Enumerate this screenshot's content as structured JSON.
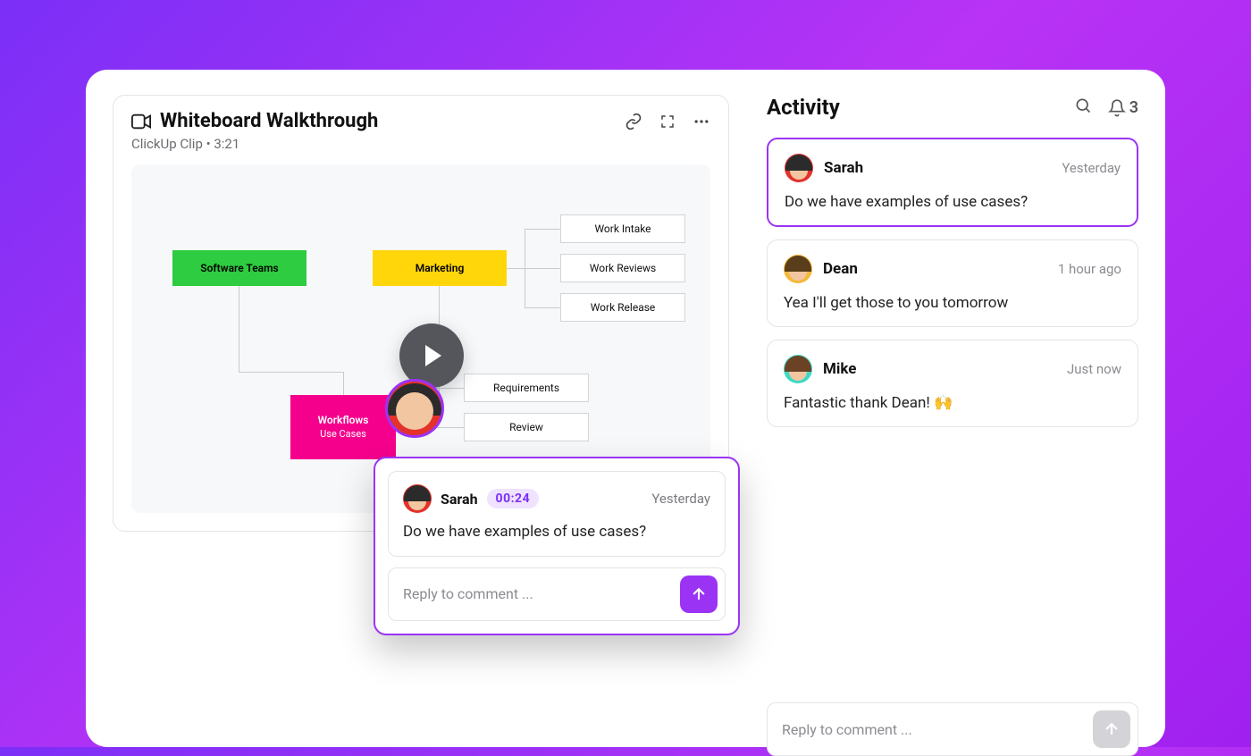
{
  "clip": {
    "title": "Whiteboard Walkthrough",
    "subtitle": "ClickUp Clip  •  3:21"
  },
  "whiteboard": {
    "software_teams": "Software Teams",
    "marketing": "Marketing",
    "workflows": "Workflows",
    "workflows_sub": "Use Cases",
    "work_intake": "Work Intake",
    "work_reviews": "Work Reviews",
    "work_release": "Work Release",
    "requirements": "Requirements",
    "review": "Review"
  },
  "popup": {
    "author": "Sarah",
    "timestamp_badge": "00:24",
    "relative_time": "Yesterday",
    "body": "Do we have examples of use cases?",
    "reply_placeholder": "Reply to comment ..."
  },
  "activity": {
    "heading": "Activity",
    "notification_count": "3",
    "reply_placeholder": "Reply to comment ...",
    "comments": [
      {
        "author": "Sarah",
        "time": "Yesterday",
        "body": "Do we have examples of use cases?"
      },
      {
        "author": "Dean",
        "time": "1 hour ago",
        "body": "Yea I'll get those to you tomorrow"
      },
      {
        "author": "Mike",
        "time": "Just now",
        "body": "Fantastic thank Dean! 🙌"
      }
    ]
  }
}
